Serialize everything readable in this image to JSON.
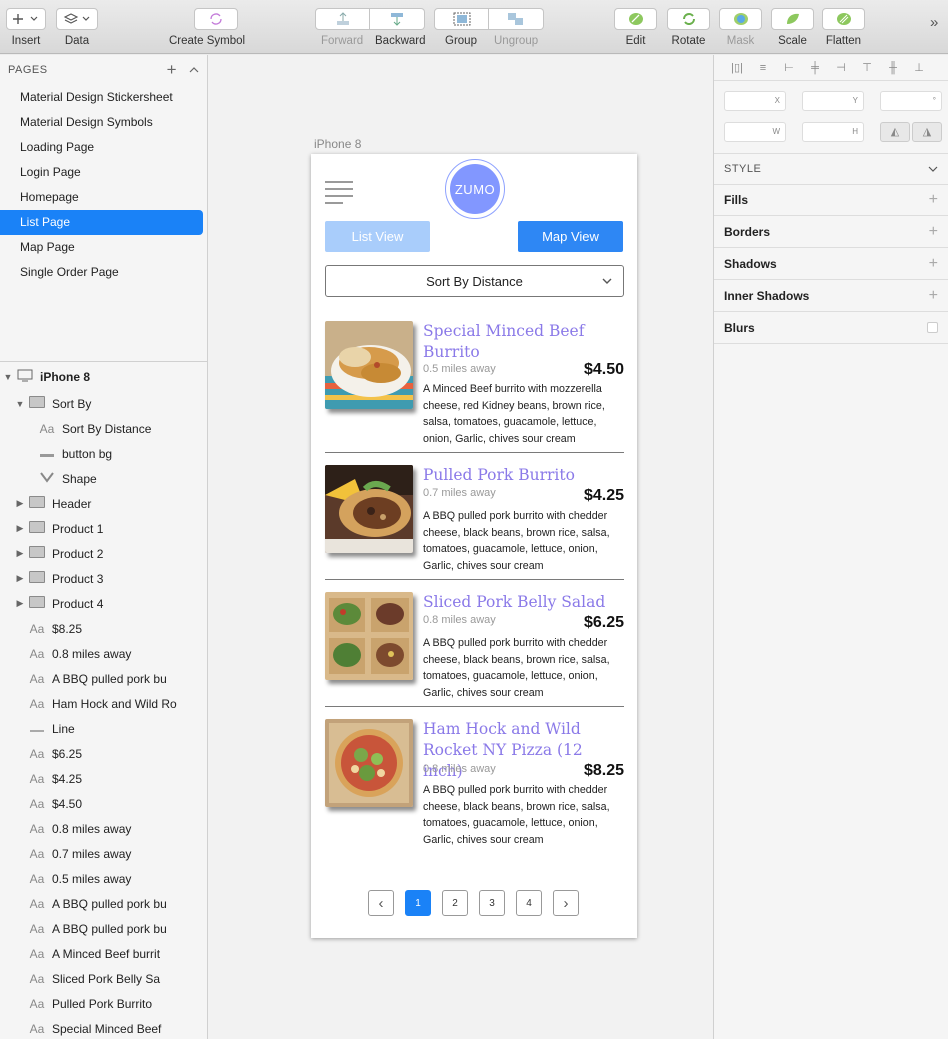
{
  "toolbar": {
    "insert": "Insert",
    "data": "Data",
    "create_symbol": "Create Symbol",
    "forward": "Forward",
    "backward": "Backward",
    "group": "Group",
    "ungroup": "Ungroup",
    "edit": "Edit",
    "rotate": "Rotate",
    "mask": "Mask",
    "scale": "Scale",
    "flatten": "Flatten",
    "overflow": "»"
  },
  "pages": {
    "heading": "PAGES",
    "items": [
      {
        "label": "Material Design Stickersheet"
      },
      {
        "label": "Material Design Symbols"
      },
      {
        "label": "Loading Page"
      },
      {
        "label": "Login Page"
      },
      {
        "label": "Homepage"
      },
      {
        "label": "List Page"
      },
      {
        "label": "Map Page"
      },
      {
        "label": "Single Order Page"
      }
    ],
    "active": "List Page"
  },
  "layers": {
    "artboard": "iPhone 8",
    "items": [
      {
        "label": "Sort By"
      },
      {
        "label": "Sort By Distance"
      },
      {
        "label": "button bg"
      },
      {
        "label": "Shape"
      },
      {
        "label": "Header"
      },
      {
        "label": "Product 1"
      },
      {
        "label": "Product 2"
      },
      {
        "label": "Product 3"
      },
      {
        "label": "Product 4"
      },
      {
        "label": "$8.25"
      },
      {
        "label": "0.8 miles away"
      },
      {
        "label": "A BBQ pulled pork bu"
      },
      {
        "label": "Ham Hock and Wild Ro"
      },
      {
        "label": "Line"
      },
      {
        "label": "$6.25"
      },
      {
        "label": "$4.25"
      },
      {
        "label": "$4.50"
      },
      {
        "label": "0.8 miles away"
      },
      {
        "label": "0.7 miles away"
      },
      {
        "label": "0.5 miles away"
      },
      {
        "label": "A BBQ pulled pork bu"
      },
      {
        "label": "A BBQ pulled pork bu"
      },
      {
        "label": "A Minced Beef burrit"
      },
      {
        "label": "Sliced Pork Belly Sa"
      },
      {
        "label": "Pulled Pork Burrito"
      },
      {
        "label": "Special Minced Beef"
      }
    ]
  },
  "canvas": {
    "artboard_label": "iPhone 8"
  },
  "app": {
    "logo": "ZUMO",
    "list_view": "List View",
    "map_view": "Map View",
    "sort": "Sort By Distance",
    "products": [
      {
        "name": "Special Minced Beef Burrito",
        "distance": "0.5 miles away",
        "price": "$4.50",
        "description": "A Minced Beef burrito with mozzerella cheese, red Kidney beans, brown rice, salsa, tomatoes, guacamole, lettuce, onion, Garlic, chives sour cream"
      },
      {
        "name": "Pulled Pork Burrito",
        "distance": "0.7 miles away",
        "price": "$4.25",
        "description": "A BBQ pulled pork burrito with chedder cheese,  black beans, brown rice, salsa, tomatoes, guacamole, lettuce, onion, Garlic, chives sour cream"
      },
      {
        "name": "Sliced Pork Belly Salad",
        "distance": "0.8 miles away",
        "price": "$6.25",
        "description": "A BBQ pulled pork burrito with chedder cheese,  black beans, brown rice, salsa, tomatoes, guacamole, lettuce, onion, Garlic, chives sour cream"
      },
      {
        "name": "Ham Hock and Wild Rocket NY Pizza (12 inch)",
        "distance": "0.8 miles away",
        "price": "$8.25",
        "description": "A BBQ pulled pork burrito with chedder cheese,  black beans, brown rice, salsa, tomatoes, guacamole, lettuce, onion, Garlic, chives sour cream"
      }
    ],
    "pagination": {
      "prev": "‹",
      "pages": [
        "1",
        "2",
        "3",
        "4"
      ],
      "next": "›",
      "current": "1"
    }
  },
  "inspector": {
    "x_label": "X",
    "y_label": "Y",
    "rotation_label": "°",
    "w_label": "W",
    "h_label": "H",
    "style_heading": "STYLE",
    "sections": [
      {
        "label": "Fills"
      },
      {
        "label": "Borders"
      },
      {
        "label": "Shadows"
      },
      {
        "label": "Inner Shadows"
      },
      {
        "label": "Blurs"
      }
    ]
  },
  "colors": {
    "accent": "#1a82f7",
    "product_name": "#8a79e8",
    "logo": "#8297ff",
    "list_view_btn": "#a9cdfb",
    "map_view_btn": "#2e87f4"
  }
}
